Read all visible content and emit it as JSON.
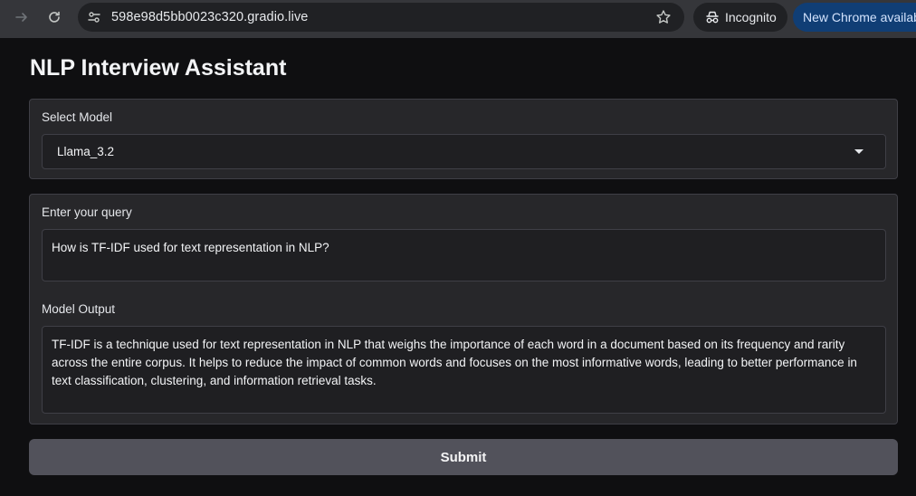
{
  "browser": {
    "url": "598e98d5bb0023c320.gradio.live",
    "incognito_label": "Incognito",
    "update_label": "New Chrome available",
    "icons": {
      "forward": "arrow-right-icon",
      "reload": "reload-icon",
      "site": "tune-icon",
      "bookmark": "star-icon",
      "incognito": "incognito-icon"
    }
  },
  "app": {
    "title": "NLP Interview Assistant",
    "model_select": {
      "label": "Select Model",
      "value": "Llama_3.2"
    },
    "query": {
      "label": "Enter your query",
      "value": "How is TF-IDF used for text representation in NLP?"
    },
    "output": {
      "label": "Model Output",
      "value": "TF-IDF is a technique used for text representation in NLP that weighs the importance of each word in a document based on its frequency and rarity across the entire corpus. It helps to reduce the impact of common words and focuses on the most informative words, leading to better performance in text classification, clustering, and information retrieval tasks."
    },
    "submit_label": "Submit"
  }
}
